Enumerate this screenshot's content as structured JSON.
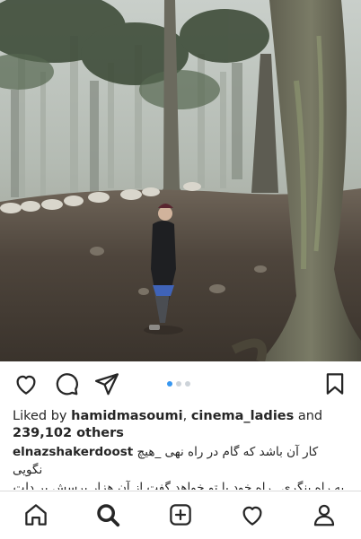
{
  "post": {
    "image_alt": "Woman standing in a foggy forest with a flock of sheep",
    "carousel": {
      "count": 3,
      "active": 0
    },
    "likes": {
      "prefix": "Liked by ",
      "user1": "hamidmasoumi",
      "separator": ", ",
      "user2": "cinema_ladies",
      "connector": " and",
      "others": "239,102 others"
    },
    "caption": {
      "username": "elnazshakerdoost",
      "line1": "کار آن باشد که گام در راه نهی _هیچ نگویی",
      "line2": "_به راه بنگری _راه خود با تو خواهد گفت از آن هزار پرسش بر دلت"
    }
  },
  "actions": {
    "like_icon": "heart-outline-icon",
    "comment_icon": "comment-bubble-icon",
    "share_icon": "paper-plane-icon",
    "save_icon": "bookmark-icon"
  },
  "nav": {
    "items": [
      {
        "name": "home",
        "icon": "home-icon"
      },
      {
        "name": "search",
        "icon": "search-icon",
        "active": true
      },
      {
        "name": "create",
        "icon": "plus-square-icon"
      },
      {
        "name": "activity",
        "icon": "heart-icon"
      },
      {
        "name": "profile",
        "icon": "person-icon"
      }
    ]
  },
  "colors": {
    "text": "#262626",
    "active_dot": "#3897f0",
    "inactive_dot": "#cdd3d9",
    "divider": "#dbdbdb"
  }
}
